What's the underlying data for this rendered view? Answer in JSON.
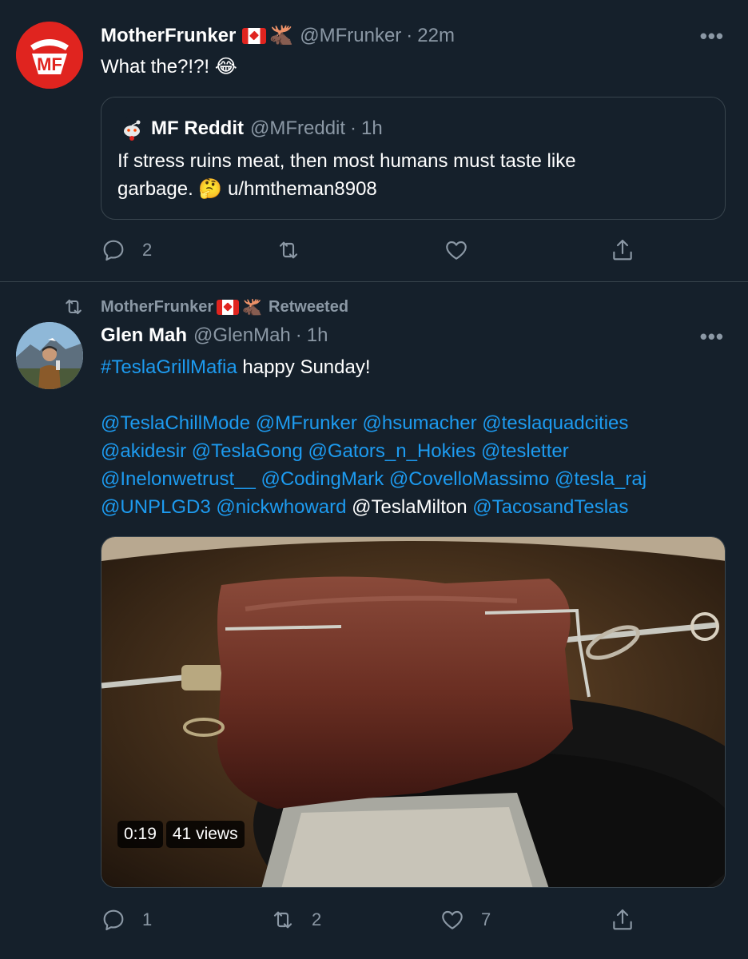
{
  "tweet1": {
    "author_name": "MotherFrunker",
    "author_handle": "@MFrunker",
    "time": "22m",
    "moose_emoji": "🫎",
    "text": "What the?!?! 😂",
    "more": "•••",
    "quote": {
      "author_name": "MF Reddit",
      "author_handle": "@MFreddit",
      "time": "1h",
      "text_line1": "If stress ruins meat, then most humans must taste like",
      "text_line2": "garbage. 🤔 u/hmtheman8908"
    },
    "actions": {
      "reply_count": "2",
      "retweet_count": "",
      "like_count": ""
    }
  },
  "retweet_banner": {
    "user": "MotherFrunker",
    "moose_emoji": "🫎",
    "label": "Retweeted"
  },
  "tweet2": {
    "author_name": "Glen Mah",
    "author_handle": "@GlenMah",
    "time": "1h",
    "more": "•••",
    "hashtag": "#TeslaGrillMafia",
    "line1_rest": " happy Sunday!",
    "mentions_line1": [
      "@TeslaChillMode",
      "@MFrunker",
      "@hsumacher",
      "@teslaquadcities"
    ],
    "mentions_line2": [
      "@akidesir",
      "@TeslaGong",
      "@Gators_n_Hokies",
      "@tesletter"
    ],
    "mentions_line3": [
      "@Inelonwetrust__",
      "@CodingMark",
      "@CovelloMassimo",
      "@tesla_raj"
    ],
    "mentions_line4": [
      "@UNPLGD3",
      "@nickwhoward",
      "@TeslaMilton",
      "@TacosandTeslas"
    ],
    "video": {
      "duration": "0:19",
      "views": "41 views"
    },
    "actions": {
      "reply_count": "1",
      "retweet_count": "2",
      "like_count": "7"
    }
  },
  "colors": {
    "background": "#15202b",
    "border": "#38444d",
    "link": "#1d9bf0",
    "muted": "#8b98a5",
    "avatar_mf": "#e0241f"
  },
  "icons": [
    "reply-icon",
    "retweet-icon",
    "like-icon",
    "share-icon",
    "more-icon",
    "canada-flag-icon",
    "moose-icon"
  ]
}
